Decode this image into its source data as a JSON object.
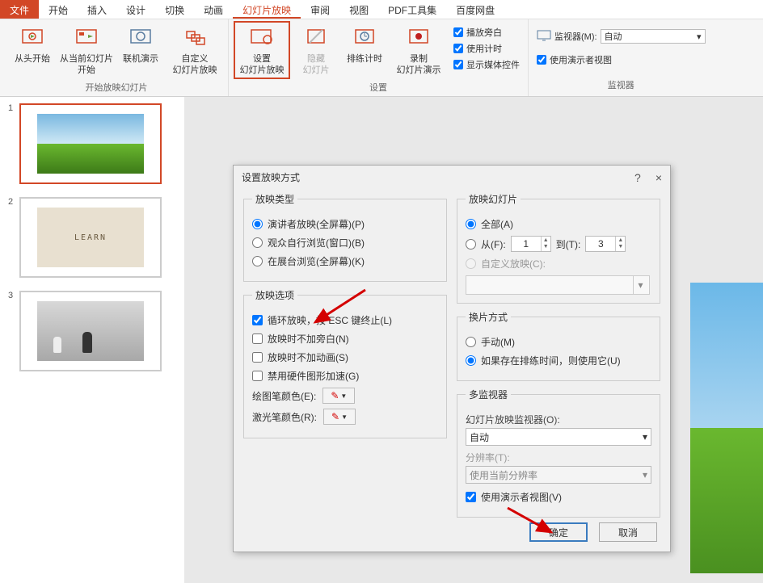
{
  "tabs": {
    "file": "文件",
    "home": "开始",
    "insert": "插入",
    "design": "设计",
    "transitions": "切换",
    "animations": "动画",
    "slideshow": "幻灯片放映",
    "review": "审阅",
    "view": "视图",
    "pdf": "PDF工具集",
    "baidu": "百度网盘"
  },
  "ribbon": {
    "btn_from_start": "从头开始",
    "btn_from_current": "从当前幻灯片\n开始",
    "btn_online": "联机演示",
    "btn_custom": "自定义\n幻灯片放映",
    "btn_setup": "设置\n幻灯片放映",
    "btn_hide": "隐藏\n幻灯片",
    "btn_rehearse": "排练计时",
    "btn_record": "录制\n幻灯片演示",
    "group_start": "开始放映幻灯片",
    "group_setup": "设置",
    "group_monitors": "监视器",
    "chk_narration": "播放旁白",
    "chk_timing": "使用计时",
    "chk_media": "显示媒体控件",
    "monitor_label": "监视器(M):",
    "monitor_value": "自动",
    "chk_presenter": "使用演示者视图"
  },
  "slides": {
    "n1": "1",
    "n2": "2",
    "n3": "3"
  },
  "dialog": {
    "title": "设置放映方式",
    "help": "?",
    "close": "×",
    "grp_type": "放映类型",
    "rb_speaker": "演讲者放映(全屏幕)(P)",
    "rb_browsed": "观众自行浏览(窗口)(B)",
    "rb_kiosk": "在展台浏览(全屏幕)(K)",
    "grp_options": "放映选项",
    "cb_loop": "循环放映，按 ESC 键终止(L)",
    "cb_no_narration": "放映时不加旁白(N)",
    "cb_no_animation": "放映时不加动画(S)",
    "cb_hw_accel": "禁用硬件图形加速(G)",
    "pen_color": "绘图笔颜色(E):",
    "laser_color": "激光笔颜色(R):",
    "grp_slides": "放映幻灯片",
    "rb_all": "全部(A)",
    "rb_from": "从(F):",
    "from_val": "1",
    "to_label": "到(T):",
    "to_val": "3",
    "rb_custom_show": "自定义放映(C):",
    "grp_advance": "换片方式",
    "rb_manual": "手动(M)",
    "rb_timings": "如果存在排练时间，则使用它(U)",
    "grp_monitors": "多监视器",
    "mon_label": "幻灯片放映监视器(O):",
    "mon_value": "自动",
    "res_label": "分辨率(T):",
    "res_value": "使用当前分辨率",
    "cb_presenter": "使用演示者视图(V)",
    "btn_ok": "确定",
    "btn_cancel": "取消"
  }
}
